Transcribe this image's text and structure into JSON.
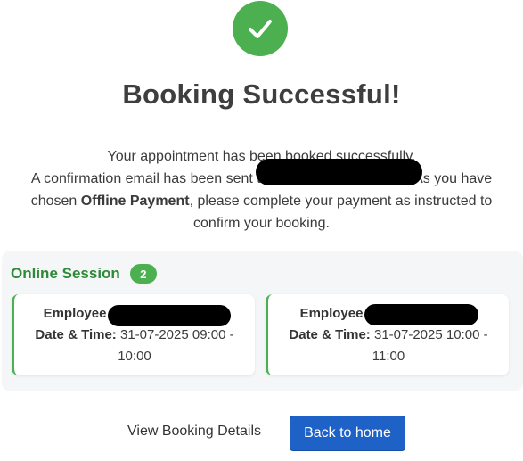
{
  "header": {
    "success_icon": "check-icon",
    "title": "Booking Successful!"
  },
  "message": {
    "line1": "Your appointment has been booked successfully.",
    "line2_prefix": "A confirmation email has been sent to",
    "line2_suffix": "As you have",
    "line3_prefix": "chosen",
    "payment_method": "Offline Payment",
    "line3_suffix": ", please complete your payment as instructed to",
    "line4": "confirm your booking."
  },
  "session": {
    "title": "Online Session",
    "count": "2",
    "cards": [
      {
        "employee_label": "Employee",
        "datetime_label": "Date & Time:",
        "datetime_value": "31-07-2025 09:00 - 10:00"
      },
      {
        "employee_label": "Employee",
        "datetime_label": "Date & Time:",
        "datetime_value": "31-07-2025 10:00 - 11:00"
      }
    ]
  },
  "actions": {
    "view_details": "View Booking Details",
    "back_home": "Back to home"
  },
  "colors": {
    "success_green": "#4cb050",
    "session_title_green": "#2e8a36",
    "primary_button": "#1e62c8"
  }
}
